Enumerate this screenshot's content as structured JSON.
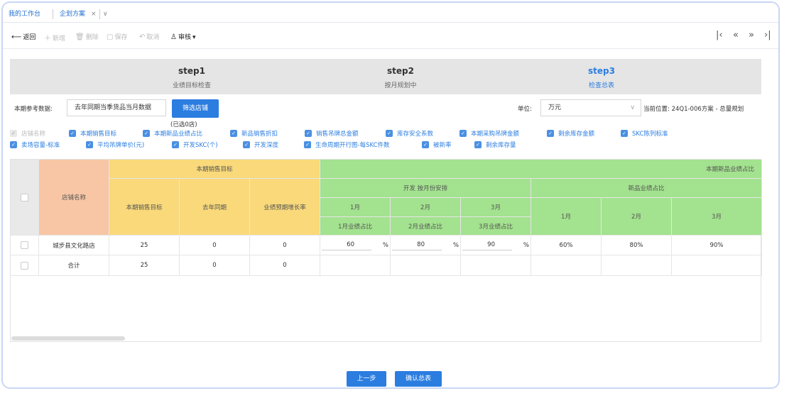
{
  "tabs": [
    {
      "label": "我的工作台"
    },
    {
      "label": "企划方案",
      "close": "×"
    }
  ],
  "tab_more": "∨",
  "toolbar": {
    "back": "返回",
    "add": "新增",
    "delete": "删除",
    "save": "保存",
    "cancel": "取消",
    "audit": "审核"
  },
  "icons": {
    "back": "⟵",
    "add": "＋",
    "delete": "🗑",
    "save": "▢",
    "cancel": "↶",
    "audit": "♙",
    "first": "|‹",
    "prev": "«",
    "next": "»",
    "last": "›|",
    "caret": "▾"
  },
  "steps": [
    {
      "title": "step1",
      "sub": "业绩目标检查"
    },
    {
      "title": "step2",
      "sub": "按月规划中"
    },
    {
      "title": "step3",
      "sub": "检查总表",
      "active": true
    }
  ],
  "filters": {
    "ref_label": "本期参考数据:",
    "ref_value": "去年同期当季货品当月数据",
    "select_btn": "筛选店铺",
    "selected_count": "(已选0店)",
    "unit_label": "单位:",
    "unit_value": "万元",
    "location": "当前位置: 24Q1-006方案 - 总量规划"
  },
  "checkboxes_row1": [
    {
      "label": "店铺名称",
      "disabled": true
    },
    {
      "label": "本期销售目标"
    },
    {
      "label": "本期新品业绩占比"
    },
    {
      "label": "新品销售折扣"
    },
    {
      "label": "销售吊牌总金额"
    },
    {
      "label": "库存安全系数"
    },
    {
      "label": "本期采购吊牌金额"
    },
    {
      "label": "剩余库存金额"
    },
    {
      "label": "SKC陈列标准"
    }
  ],
  "checkboxes_row2": [
    {
      "label": "卖场容量-标准"
    },
    {
      "label": "平均吊牌单价(元)"
    },
    {
      "label": "开发SKC(个)"
    },
    {
      "label": "开发深度"
    },
    {
      "label": "生命周期开行图-每SKC件数"
    },
    {
      "label": "被新率"
    },
    {
      "label": "剩余库存量"
    }
  ],
  "table": {
    "store_header": "店铺名称",
    "group_sales": "本期销售目标",
    "group_new": "本期新品业绩占比",
    "sub_dev": "开发 按月份安排",
    "sub_newperf": "新品业绩占比",
    "col_target": "本期销售目标",
    "col_lastyear": "去年同期",
    "col_growth": "业绩预期增长率",
    "months": [
      "1月",
      "2月",
      "3月"
    ],
    "month_perf": [
      "1月业绩占比",
      "2月业绩占比",
      "3月业绩占比"
    ],
    "rows": [
      {
        "store": "城步县文化路店",
        "target": "25",
        "lastyear": "0",
        "growth": "0",
        "inputs": [
          "60",
          "80",
          "90"
        ],
        "pct": "%",
        "ratios": [
          "60%",
          "80%",
          "90%"
        ]
      },
      {
        "store": "合计",
        "target": "25",
        "lastyear": "0",
        "growth": "0"
      }
    ]
  },
  "buttons": {
    "prev": "上一步",
    "confirm": "确认总表"
  }
}
